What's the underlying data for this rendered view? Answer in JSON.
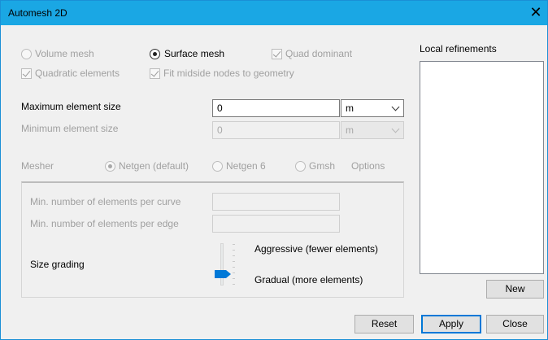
{
  "window": {
    "title": "Automesh 2D"
  },
  "mesh_type": {
    "volume_label": "Volume mesh",
    "surface_label": "Surface mesh",
    "quad_label": "Quad dominant",
    "quadratic_label": "Quadratic elements",
    "fit_label": "Fit midside nodes to geometry"
  },
  "sizes": {
    "max_label": "Maximum element size",
    "max_value": "0",
    "max_unit": "m",
    "min_label": "Minimum element size",
    "min_value": "0",
    "min_unit": "m"
  },
  "mesher": {
    "label": "Mesher",
    "netgen_default": "Netgen (default)",
    "netgen6": "Netgen 6",
    "gmsh": "Gmsh",
    "options": "Options"
  },
  "options_group": {
    "curve_label": "Min. number of elements per curve",
    "edge_label": "Min. number of elements per edge",
    "grading_label": "Size grading",
    "aggressive_label": "Aggressive (fewer elements)",
    "gradual_label": "Gradual (more elements)"
  },
  "local_refinements": {
    "title": "Local refinements",
    "new_label": "New"
  },
  "footer": {
    "reset_label": "Reset",
    "apply_label": "Apply",
    "close_label": "Close"
  }
}
